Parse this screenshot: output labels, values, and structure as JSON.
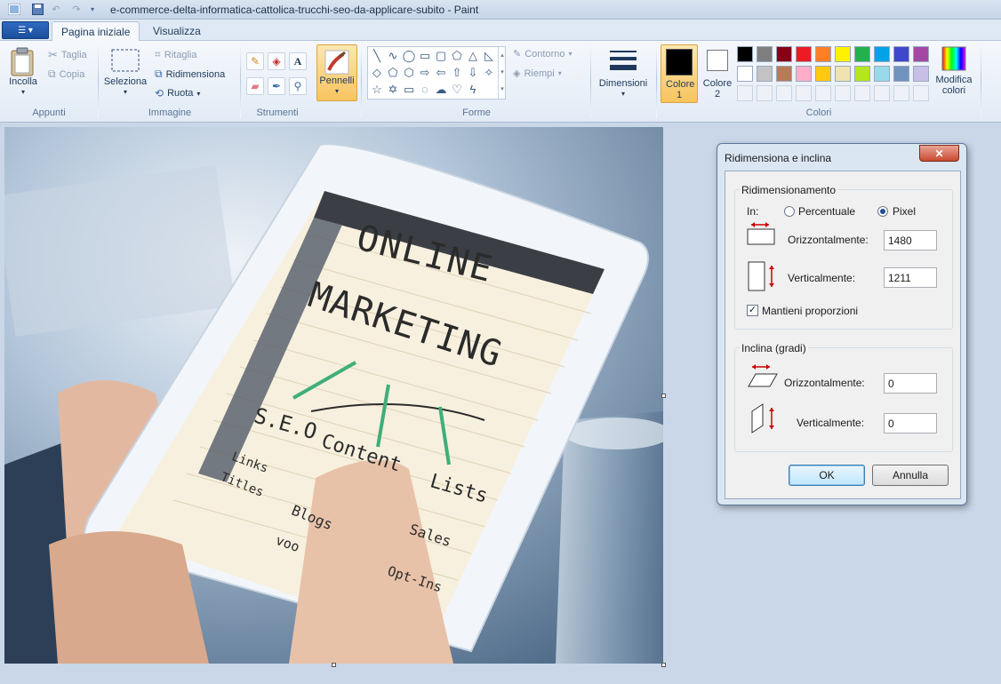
{
  "window": {
    "title": "e-commerce-delta-informatica-cattolica-trucchi-seo-da-applicare-subito - Paint"
  },
  "tabs": [
    {
      "label": "Pagina iniziale",
      "active": true
    },
    {
      "label": "Visualizza",
      "active": false
    }
  ],
  "ribbon": {
    "clipboard": {
      "paste": "Incolla",
      "cut": "Taglia",
      "copy": "Copia",
      "group": "Appunti"
    },
    "image": {
      "select": "Seleziona",
      "crop": "Ritaglia",
      "resize": "Ridimensiona",
      "rotate": "Ruota",
      "group": "Immagine"
    },
    "tools": {
      "group": "Strumenti"
    },
    "brushes": {
      "label": "Pennelli"
    },
    "shapes": {
      "outline": "Contorno",
      "fill": "Riempi",
      "group": "Forme"
    },
    "size": {
      "label": "Dimensioni"
    },
    "colors": {
      "color1": "Colore 1",
      "color2": "Colore 2",
      "edit": "Modifica colori",
      "group": "Colori",
      "color1_value": "#000000",
      "color2_value": "#ffffff",
      "palette_row1": [
        "#000000",
        "#7f7f7f",
        "#880015",
        "#ed1c24",
        "#ff7f27",
        "#fff200",
        "#22b14c",
        "#00a2e8",
        "#3f48cc",
        "#a349a4"
      ],
      "palette_row2": [
        "#ffffff",
        "#c3c3c3",
        "#b97a57",
        "#ffaec9",
        "#ffc90e",
        "#efe4b0",
        "#b5e61d",
        "#99d9ea",
        "#7092be",
        "#c8bfe7"
      ]
    }
  },
  "canvas": {
    "photo_text": {
      "line1": "ONLINE",
      "line2": "MARKETING",
      "seo": "S.E.O",
      "content": "Content",
      "lists": "Lists",
      "links": "Links",
      "titles": "Titles",
      "blogs": "Blogs",
      "sales": "Sales",
      "voo": "voo",
      "optins": "Opt-Ins"
    }
  },
  "dialog": {
    "title": "Ridimensiona e inclina",
    "resize_section": "Ridimensionamento",
    "in_label": "In:",
    "percent_label": "Percentuale",
    "pixel_label": "Pixel",
    "unit_selected": "Pixel",
    "horizontal_label": "Orizzontalmente:",
    "vertical_label": "Verticalmente:",
    "horizontal_value": "1480",
    "vertical_value": "1211",
    "keep_ratio_label": "Mantieni proporzioni",
    "keep_ratio_checked": true,
    "skew_section": "Inclina (gradi)",
    "skew_horizontal_label": "Orizzontalmente:",
    "skew_vertical_label": "Verticalmente:",
    "skew_horizontal_value": "0",
    "skew_vertical_value": "0",
    "ok": "OK",
    "cancel": "Annulla"
  }
}
